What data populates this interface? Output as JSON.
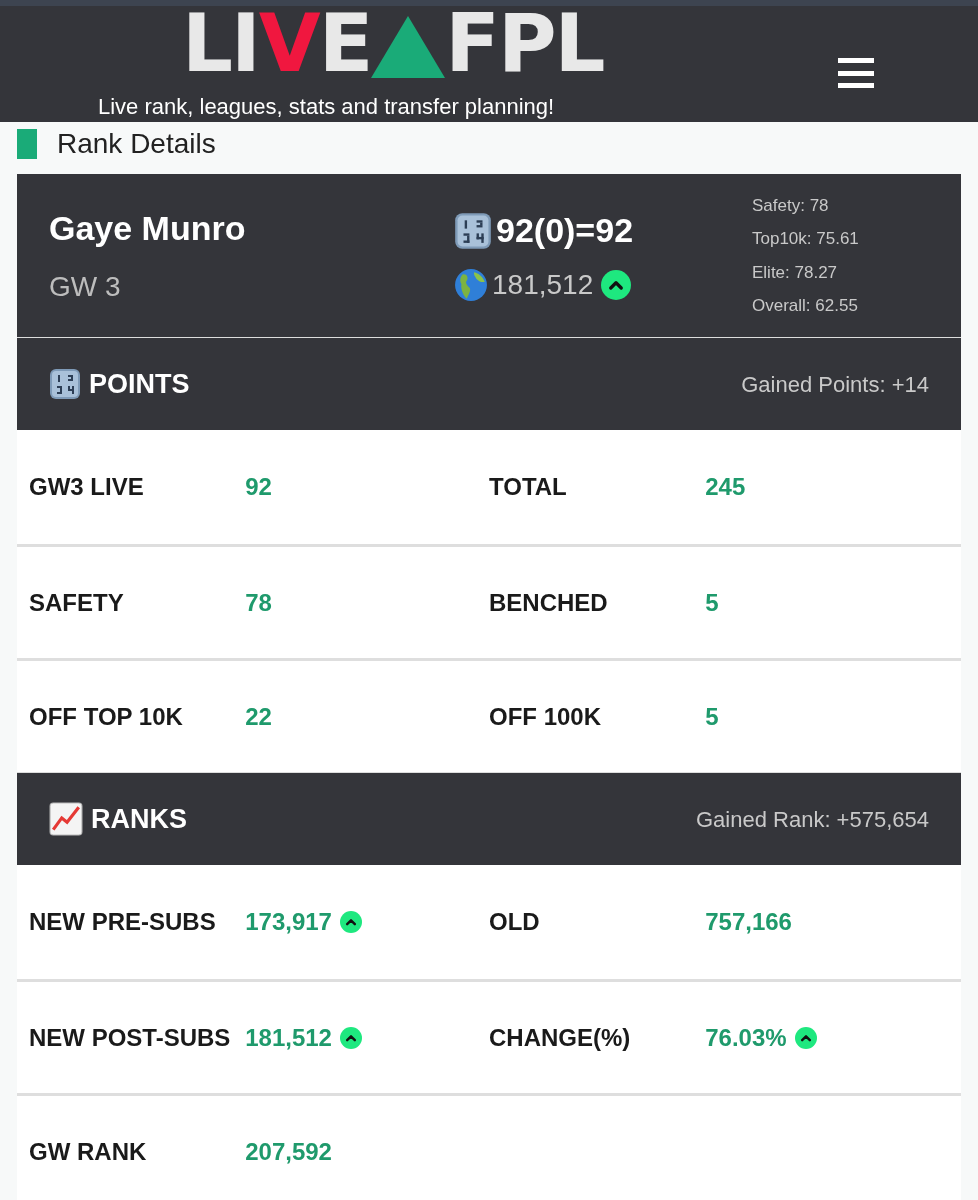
{
  "header": {
    "logo": [
      {
        "kind": "letters",
        "text": "LI"
      },
      {
        "kind": "accent",
        "text": "V"
      },
      {
        "kind": "letters",
        "text": "E"
      },
      {
        "kind": "triangle"
      },
      {
        "kind": "letters",
        "text": "FPL"
      }
    ],
    "tagline": "Live rank, leagues, stats and transfer planning!"
  },
  "section_title": "Rank Details",
  "summary": {
    "name": "Gaye Munro",
    "gameweek": "GW 3",
    "score": "92(0)=92",
    "rank": "181,512",
    "rank_up": true,
    "averages": [
      "Safety: 78",
      "Top10k: 75.61",
      "Elite: 78.27",
      "Overall: 62.55"
    ]
  },
  "sections": [
    {
      "kind": "points",
      "title": "POINTS",
      "gained": "Gained Points: +14",
      "rows": [
        [
          {
            "label": "GW3 LIVE",
            "value": "92",
            "up": false
          },
          {
            "label": "TOTAL",
            "value": "245",
            "up": false
          }
        ],
        [
          {
            "label": "SAFETY",
            "value": "78",
            "up": false
          },
          {
            "label": "BENCHED",
            "value": "5",
            "up": false
          }
        ],
        [
          {
            "label": "OFF TOP 10K",
            "value": "22",
            "up": false
          },
          {
            "label": "OFF 100K",
            "value": "5",
            "up": false
          }
        ]
      ]
    },
    {
      "kind": "ranks",
      "title": "RANKS",
      "gained": "Gained Rank: +575,654",
      "rows": [
        [
          {
            "label": "NEW PRE-SUBS",
            "value": "173,917",
            "up": true
          },
          {
            "label": "OLD",
            "value": "757,166",
            "up": false
          }
        ],
        [
          {
            "label": "NEW POST-SUBS",
            "value": "181,512",
            "up": true
          },
          {
            "label": "CHANGE(%)",
            "value": "76.03%",
            "up": true
          }
        ],
        [
          {
            "label": "GW RANK",
            "value": "207,592",
            "up": false
          }
        ]
      ]
    }
  ]
}
